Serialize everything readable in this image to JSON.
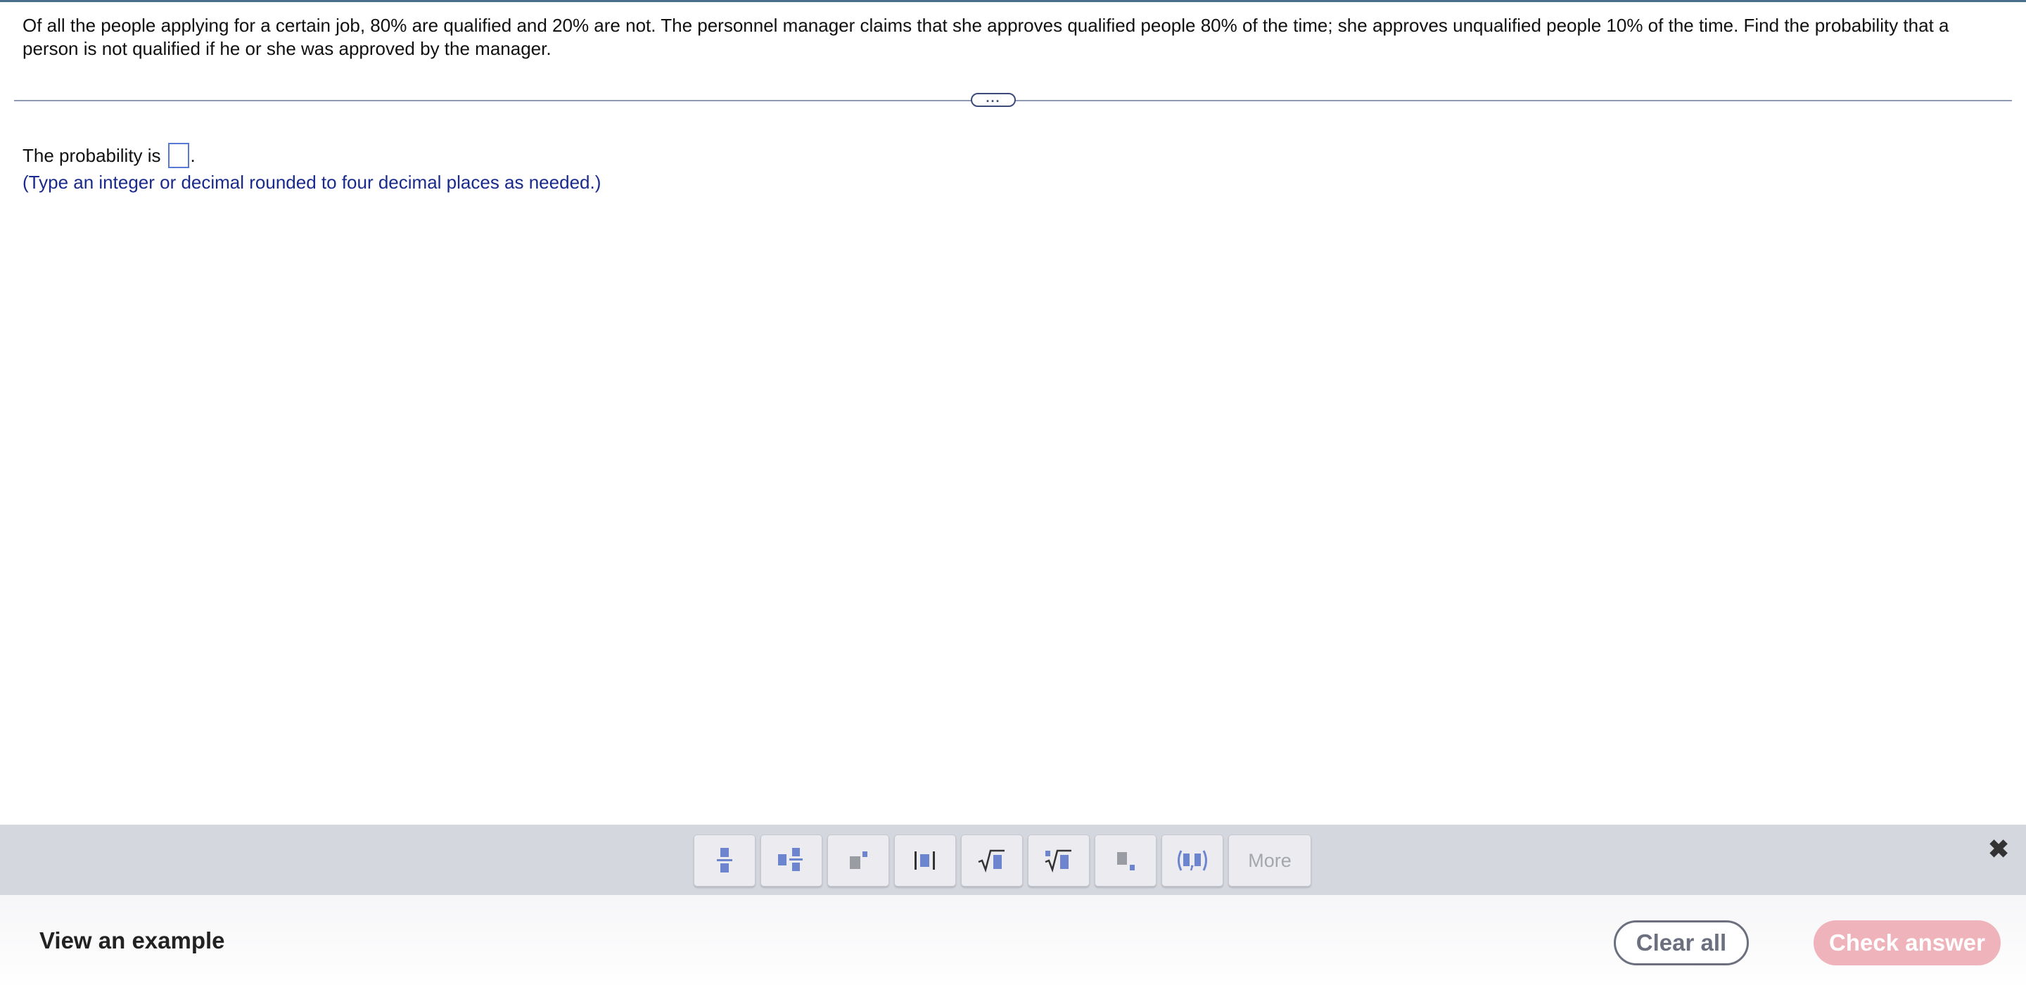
{
  "question": {
    "text": "Of all the people applying for a certain job, 80% are qualified and 20% are not. The personnel manager claims that she approves qualified people 80% of the time; she approves unqualified people 10% of the time. Find the probability that a person is not qualified if he or she was approved by the manager."
  },
  "answer": {
    "prefix": "The probability is",
    "suffix": ".",
    "value": ""
  },
  "hint": "(Type an integer or decimal rounded to four decimal places as needed.)",
  "toolbar": {
    "buttons": [
      {
        "icon": "fraction-icon"
      },
      {
        "icon": "mixed-number-icon"
      },
      {
        "icon": "exponent-icon"
      },
      {
        "icon": "absolute-value-icon"
      },
      {
        "icon": "square-root-icon"
      },
      {
        "icon": "nth-root-icon"
      },
      {
        "icon": "subscript-icon"
      },
      {
        "icon": "ordered-pair-icon"
      }
    ],
    "more_label": "More",
    "close_icon": "close-icon"
  },
  "footer": {
    "view_example": "View an example",
    "clear_all": "Clear all",
    "check_answer": "Check answer"
  },
  "colors": {
    "icon_blue": "#6d84cf",
    "icon_gray": "#9a9ca3",
    "check_answer_bg": "#efb3bb",
    "hint_text": "#1a2a8c"
  }
}
